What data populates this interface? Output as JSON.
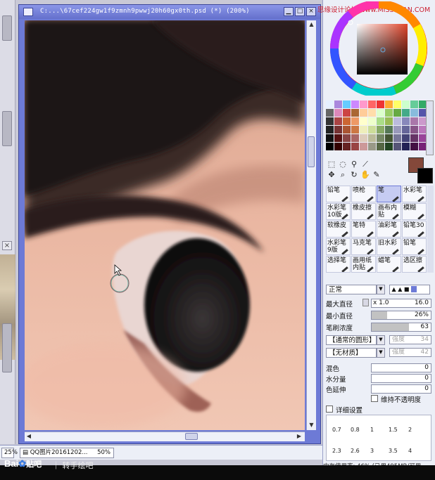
{
  "watermark_top": "思缘设计论坛 www.MISSYUAN.COM",
  "canvas_window": {
    "title": "C:...\\67cef224gw1f9zmnh9pwwj20h60gx0th.psd (*) (200%)"
  },
  "brushes": [
    "铅笔",
    "喷枪",
    "笔",
    "水彩笔",
    "水彩笔10版",
    "橡皮擦",
    "画布内贴",
    "模糊",
    "软橡皮",
    "笔特",
    "油彩笔",
    "铅笔30",
    "水彩笔9版",
    "马克笔",
    "旧水彩",
    "铅笔",
    "选择笔",
    "画用纸内贴",
    "蜡笔",
    "选区擦"
  ],
  "brush_props": {
    "blend_mode": "正常",
    "max_diameter_label": "最大直径",
    "max_diameter_mult": "x 1.0",
    "max_diameter_value": "16.0",
    "min_diameter_label": "最小直径",
    "min_diameter_value": "26%",
    "min_diameter_pct": 26,
    "density_label": "笔刷浓度",
    "density_value": "63",
    "density_pct": 63,
    "shape_dropdown": "【通常的圆形】",
    "shape_strength_label": "强度",
    "shape_strength_value": "34",
    "texture_dropdown": "【无材质】",
    "texture_strength_label": "强度",
    "texture_strength_value": "42",
    "blend_label": "混色",
    "blend_value": "0",
    "water_label": "水分量",
    "water_value": "0",
    "extend_label": "色延伸",
    "extend_value": "0",
    "keep_opacity_label": "维持不透明度",
    "detail_settings_label": "详细设置"
  },
  "size_presets": [
    "0.7",
    "0.8",
    "1",
    "1.5",
    "2",
    "2.3",
    "2.6",
    "3",
    "3.5",
    "4"
  ],
  "status_line": "内存使用率: 46% (已用495MB/可用",
  "bottom_bar": {
    "left_zoom": "25%",
    "tab_name": "QQ图片20161202...",
    "tab_zoom": "50%"
  },
  "footer": {
    "logo_text": "Bai",
    "logo_suffix": "贴吧",
    "caption": "转手绘吧"
  },
  "colors": {
    "main_color": "#84483a",
    "sub_color": "#000000",
    "window_accent": "#6d7ad6"
  }
}
